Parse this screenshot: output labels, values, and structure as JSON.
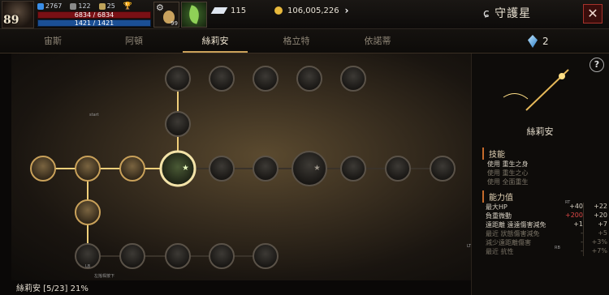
{
  "player": {
    "level": "89",
    "attack_value": "2767",
    "stat2": "122",
    "stat3": "25",
    "hp": "6834 / 6834",
    "mp": "1421 / 1421"
  },
  "slots": {
    "gear_badge": "99"
  },
  "resources": {
    "feather": "115",
    "gold": "106,005,226"
  },
  "window": {
    "title": "守護星",
    "close": "✕"
  },
  "tabs": [
    {
      "label": "宙斯",
      "active": false
    },
    {
      "label": "阿頓",
      "active": false
    },
    {
      "label": "絲莉安",
      "active": true
    },
    {
      "label": "格立特",
      "active": false
    },
    {
      "label": "依諾蒂",
      "active": false
    }
  ],
  "gem_count": "2",
  "tree": {
    "start_label": "start",
    "bottom_label": "LB",
    "bottom_sublabel": "左搖桿按下",
    "side_label": "LT",
    "rb_label": "RB",
    "rt_label": "RT",
    "status": "絲莉安 [5/23] 21%"
  },
  "panel": {
    "help": "?",
    "name": "絲莉安",
    "skills_title": "技能",
    "skills": [
      {
        "label": "使用 重生之身",
        "dim": false
      },
      {
        "label": "使用 重生之心",
        "dim": true
      },
      {
        "label": "使用 全面重生",
        "dim": true
      }
    ],
    "attrs_title": "能力值",
    "attrs": [
      {
        "name": "最大HP",
        "v1": "+40",
        "v2": "+22",
        "red": false,
        "dim": false
      },
      {
        "name": "負重微動",
        "v1": "+200",
        "v2": "+20",
        "red": true,
        "dim": false
      },
      {
        "name": "遠距離 遠遠傷害減免",
        "v1": "+1",
        "v2": "+7",
        "red": false,
        "dim": false
      },
      {
        "name": "最近 狀態傷害減免",
        "v1": "-",
        "v2": "+5",
        "red": false,
        "dim": true
      },
      {
        "name": "減少遠距離傷害",
        "v1": "-",
        "v2": "+3%",
        "red": false,
        "dim": true
      },
      {
        "name": "最近 抗性",
        "v1": "-",
        "v2": "+7%",
        "red": false,
        "dim": true
      }
    ]
  },
  "colors": {
    "accent": "#caa15a",
    "close_red": "#a8322c",
    "hp": "#7a1015",
    "mp": "#1b4f95",
    "negative": "#e04848"
  }
}
